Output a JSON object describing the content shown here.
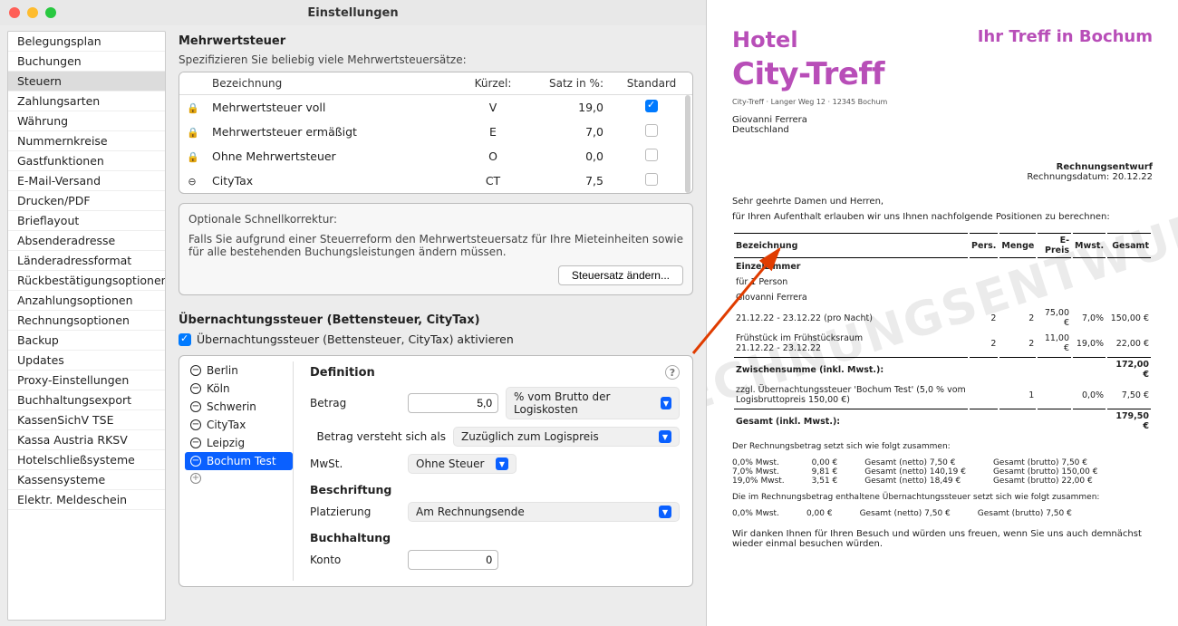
{
  "window": {
    "title": "Einstellungen"
  },
  "sidebar": {
    "items": [
      "Belegungsplan",
      "Buchungen",
      "Steuern",
      "Zahlungsarten",
      "Währung",
      "Nummernkreise",
      "Gastfunktionen",
      "E-Mail-Versand",
      "Drucken/PDF",
      "Brieflayout",
      "Absenderadresse",
      "Länderadressformat",
      "Rückbestätigungsoptionen",
      "Anzahlungsoptionen",
      "Rechnungsoptionen",
      "Backup",
      "Updates",
      "Proxy-Einstellungen",
      "Buchhaltungsexport",
      "KassenSichV TSE",
      "Kassa Austria RKSV",
      "Hotelschließsysteme",
      "Kassensysteme",
      "Elektr. Meldeschein"
    ],
    "selected": 2
  },
  "vat": {
    "heading": "Mehrwertsteuer",
    "desc": "Spezifizieren Sie beliebig viele Mehrwertsteuersätze:",
    "cols": {
      "name": "Bezeichnung",
      "kurz": "Kürzel:",
      "satz": "Satz in %:",
      "std": "Standard"
    },
    "rows": [
      {
        "locked": true,
        "name": "Mehrwertsteuer voll",
        "kurz": "V",
        "satz": "19,0",
        "std": true
      },
      {
        "locked": true,
        "name": "Mehrwertsteuer ermäßigt",
        "kurz": "E",
        "satz": "7,0",
        "std": false
      },
      {
        "locked": true,
        "name": "Ohne Mehrwertsteuer",
        "kurz": "O",
        "satz": "0,0",
        "std": false
      },
      {
        "locked": false,
        "name": "CityTax",
        "kurz": "CT",
        "satz": "7,5",
        "std": false
      }
    ]
  },
  "correction": {
    "heading": "Optionale Schnellkorrektur:",
    "desc": "Falls Sie aufgrund einer Steuerreform den Mehrwertsteuersatz für Ihre Mieteinheiten sowie für alle bestehenden Buchungsleistungen ändern müssen.",
    "button": "Steuersatz ändern..."
  },
  "acc_tax": {
    "heading": "Übernachtungssteuer (Bettensteuer, CityTax)",
    "enable_label": "Übernachtungssteuer (Bettensteuer, CityTax) aktivieren",
    "items": [
      "Berlin",
      "Köln",
      "Schwerin",
      "CityTax",
      "Leipzig",
      "Bochum Test"
    ],
    "selected": 5,
    "definition_label": "Definition",
    "betrag_label": "Betrag",
    "betrag_value": "5,0",
    "betrag_unit": "% vom Brutto der Logiskosten",
    "understand_label": "Betrag versteht sich als",
    "understand_value": "Zuzüglich zum Logispreis",
    "mwst_label": "MwSt.",
    "mwst_value": "Ohne Steuer",
    "caption_heading": "Beschriftung",
    "placement_label": "Platzierung",
    "placement_value": "Am Rechnungsende",
    "accounting_heading": "Buchhaltung",
    "account_label": "Konto",
    "account_value": "0"
  },
  "invoice": {
    "logo_top": "Hotel",
    "logo_main": "City-Treff",
    "slogan": "Ihr Treff in Bochum",
    "addr_line": "City-Treff · Langer Weg 12 · 12345 Bochum",
    "recipient_name": "Giovanni Ferrera",
    "recipient_country": "Deutschland",
    "doc_type": "Rechnungsentwurf",
    "date_label": "Rechnungsdatum: 20.12.22",
    "salutation": "Sehr geehrte Damen und Herren,",
    "intro": "für Ihren Aufenthalt erlauben wir uns Ihnen nachfolgende Positionen zu berechnen:",
    "cols": {
      "desc": "Bezeichnung",
      "pers": "Pers.",
      "menge": "Menge",
      "eprice": "E-Preis",
      "mwst": "Mwst.",
      "total": "Gesamt"
    },
    "item1_name": "Einzelzimmer",
    "item1_for": "für 1 Person",
    "item1_guest": "Giovanni Ferrera",
    "item1_dates": "21.12.22 - 23.12.22 (pro Nacht)",
    "item1_pers": "2",
    "item1_menge": "2",
    "item1_eprice": "75,00 €",
    "item1_mwst": "7,0%",
    "item1_total": "150,00 €",
    "item2_name": "Frühstück im Frühstücksraum",
    "item2_dates": "21.12.22 - 23.12.22",
    "item2_pers": "2",
    "item2_menge": "2",
    "item2_eprice": "11,00 €",
    "item2_mwst": "19,0%",
    "item2_total": "22,00 €",
    "subtotal_label": "Zwischensumme (inkl. Mwst.):",
    "subtotal_value": "172,00 €",
    "surcharge_text": "zzgl. Übernachtungssteuer 'Bochum Test' (5,0 % vom Logisbruttopreis 150,00 €)",
    "surcharge_menge": "1",
    "surcharge_mwst": "0,0%",
    "surcharge_total": "7,50 €",
    "grand_label": "Gesamt (inkl. Mwst.):",
    "grand_value": "179,50 €",
    "breakdown_intro": "Der Rechnungsbetrag setzt sich wie folgt zusammen:",
    "breakdown": [
      {
        "rate": "0,0% Mwst.",
        "amt": "0,00 €",
        "net": "Gesamt (netto) 7,50 €",
        "gross": "Gesamt (brutto) 7,50 €"
      },
      {
        "rate": "7,0% Mwst.",
        "amt": "9,81 €",
        "net": "Gesamt (netto) 140,19 €",
        "gross": "Gesamt (brutto) 150,00 €"
      },
      {
        "rate": "19,0% Mwst.",
        "amt": "3,51 €",
        "net": "Gesamt (netto) 18,49 €",
        "gross": "Gesamt (brutto) 22,00 €"
      }
    ],
    "acc_breakdown_intro": "Die im Rechnungsbetrag enthaltene Übernachtungssteuer setzt sich wie folgt zusammen:",
    "acc_breakdown": {
      "rate": "0,0% Mwst.",
      "amt": "0,00 €",
      "net": "Gesamt (netto) 7,50 €",
      "gross": "Gesamt (brutto) 7,50 €"
    },
    "closing": "Wir danken Ihnen für Ihren Besuch und würden uns freuen, wenn Sie uns auch demnächst wieder einmal besuchen würden.",
    "watermark": "RECHNUNGSENTWURF"
  }
}
